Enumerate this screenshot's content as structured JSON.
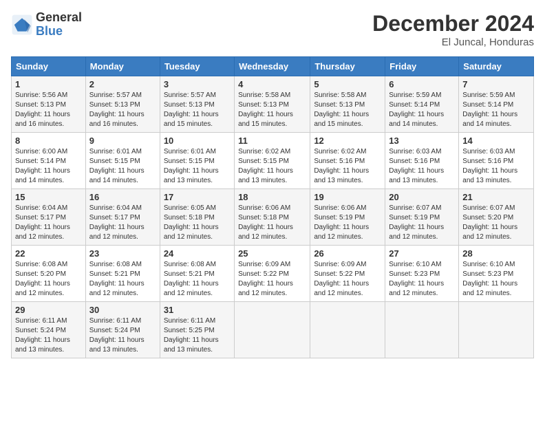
{
  "header": {
    "logo_general": "General",
    "logo_blue": "Blue",
    "month_title": "December 2024",
    "location": "El Juncal, Honduras"
  },
  "days_of_week": [
    "Sunday",
    "Monday",
    "Tuesday",
    "Wednesday",
    "Thursday",
    "Friday",
    "Saturday"
  ],
  "weeks": [
    [
      {
        "day": "1",
        "sunrise": "Sunrise: 5:56 AM",
        "sunset": "Sunset: 5:13 PM",
        "daylight": "Daylight: 11 hours and 16 minutes."
      },
      {
        "day": "2",
        "sunrise": "Sunrise: 5:57 AM",
        "sunset": "Sunset: 5:13 PM",
        "daylight": "Daylight: 11 hours and 16 minutes."
      },
      {
        "day": "3",
        "sunrise": "Sunrise: 5:57 AM",
        "sunset": "Sunset: 5:13 PM",
        "daylight": "Daylight: 11 hours and 15 minutes."
      },
      {
        "day": "4",
        "sunrise": "Sunrise: 5:58 AM",
        "sunset": "Sunset: 5:13 PM",
        "daylight": "Daylight: 11 hours and 15 minutes."
      },
      {
        "day": "5",
        "sunrise": "Sunrise: 5:58 AM",
        "sunset": "Sunset: 5:13 PM",
        "daylight": "Daylight: 11 hours and 15 minutes."
      },
      {
        "day": "6",
        "sunrise": "Sunrise: 5:59 AM",
        "sunset": "Sunset: 5:14 PM",
        "daylight": "Daylight: 11 hours and 14 minutes."
      },
      {
        "day": "7",
        "sunrise": "Sunrise: 5:59 AM",
        "sunset": "Sunset: 5:14 PM",
        "daylight": "Daylight: 11 hours and 14 minutes."
      }
    ],
    [
      {
        "day": "8",
        "sunrise": "Sunrise: 6:00 AM",
        "sunset": "Sunset: 5:14 PM",
        "daylight": "Daylight: 11 hours and 14 minutes."
      },
      {
        "day": "9",
        "sunrise": "Sunrise: 6:01 AM",
        "sunset": "Sunset: 5:15 PM",
        "daylight": "Daylight: 11 hours and 14 minutes."
      },
      {
        "day": "10",
        "sunrise": "Sunrise: 6:01 AM",
        "sunset": "Sunset: 5:15 PM",
        "daylight": "Daylight: 11 hours and 13 minutes."
      },
      {
        "day": "11",
        "sunrise": "Sunrise: 6:02 AM",
        "sunset": "Sunset: 5:15 PM",
        "daylight": "Daylight: 11 hours and 13 minutes."
      },
      {
        "day": "12",
        "sunrise": "Sunrise: 6:02 AM",
        "sunset": "Sunset: 5:16 PM",
        "daylight": "Daylight: 11 hours and 13 minutes."
      },
      {
        "day": "13",
        "sunrise": "Sunrise: 6:03 AM",
        "sunset": "Sunset: 5:16 PM",
        "daylight": "Daylight: 11 hours and 13 minutes."
      },
      {
        "day": "14",
        "sunrise": "Sunrise: 6:03 AM",
        "sunset": "Sunset: 5:16 PM",
        "daylight": "Daylight: 11 hours and 13 minutes."
      }
    ],
    [
      {
        "day": "15",
        "sunrise": "Sunrise: 6:04 AM",
        "sunset": "Sunset: 5:17 PM",
        "daylight": "Daylight: 11 hours and 12 minutes."
      },
      {
        "day": "16",
        "sunrise": "Sunrise: 6:04 AM",
        "sunset": "Sunset: 5:17 PM",
        "daylight": "Daylight: 11 hours and 12 minutes."
      },
      {
        "day": "17",
        "sunrise": "Sunrise: 6:05 AM",
        "sunset": "Sunset: 5:18 PM",
        "daylight": "Daylight: 11 hours and 12 minutes."
      },
      {
        "day": "18",
        "sunrise": "Sunrise: 6:06 AM",
        "sunset": "Sunset: 5:18 PM",
        "daylight": "Daylight: 11 hours and 12 minutes."
      },
      {
        "day": "19",
        "sunrise": "Sunrise: 6:06 AM",
        "sunset": "Sunset: 5:19 PM",
        "daylight": "Daylight: 11 hours and 12 minutes."
      },
      {
        "day": "20",
        "sunrise": "Sunrise: 6:07 AM",
        "sunset": "Sunset: 5:19 PM",
        "daylight": "Daylight: 11 hours and 12 minutes."
      },
      {
        "day": "21",
        "sunrise": "Sunrise: 6:07 AM",
        "sunset": "Sunset: 5:20 PM",
        "daylight": "Daylight: 11 hours and 12 minutes."
      }
    ],
    [
      {
        "day": "22",
        "sunrise": "Sunrise: 6:08 AM",
        "sunset": "Sunset: 5:20 PM",
        "daylight": "Daylight: 11 hours and 12 minutes."
      },
      {
        "day": "23",
        "sunrise": "Sunrise: 6:08 AM",
        "sunset": "Sunset: 5:21 PM",
        "daylight": "Daylight: 11 hours and 12 minutes."
      },
      {
        "day": "24",
        "sunrise": "Sunrise: 6:08 AM",
        "sunset": "Sunset: 5:21 PM",
        "daylight": "Daylight: 11 hours and 12 minutes."
      },
      {
        "day": "25",
        "sunrise": "Sunrise: 6:09 AM",
        "sunset": "Sunset: 5:22 PM",
        "daylight": "Daylight: 11 hours and 12 minutes."
      },
      {
        "day": "26",
        "sunrise": "Sunrise: 6:09 AM",
        "sunset": "Sunset: 5:22 PM",
        "daylight": "Daylight: 11 hours and 12 minutes."
      },
      {
        "day": "27",
        "sunrise": "Sunrise: 6:10 AM",
        "sunset": "Sunset: 5:23 PM",
        "daylight": "Daylight: 11 hours and 12 minutes."
      },
      {
        "day": "28",
        "sunrise": "Sunrise: 6:10 AM",
        "sunset": "Sunset: 5:23 PM",
        "daylight": "Daylight: 11 hours and 12 minutes."
      }
    ],
    [
      {
        "day": "29",
        "sunrise": "Sunrise: 6:11 AM",
        "sunset": "Sunset: 5:24 PM",
        "daylight": "Daylight: 11 hours and 13 minutes."
      },
      {
        "day": "30",
        "sunrise": "Sunrise: 6:11 AM",
        "sunset": "Sunset: 5:24 PM",
        "daylight": "Daylight: 11 hours and 13 minutes."
      },
      {
        "day": "31",
        "sunrise": "Sunrise: 6:11 AM",
        "sunset": "Sunset: 5:25 PM",
        "daylight": "Daylight: 11 hours and 13 minutes."
      },
      null,
      null,
      null,
      null
    ]
  ]
}
